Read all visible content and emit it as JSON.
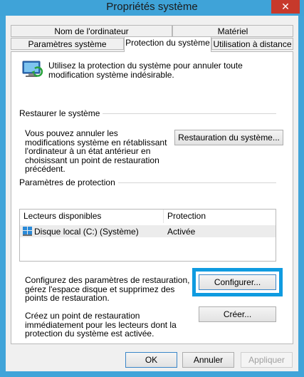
{
  "window": {
    "title": "Propriétés système",
    "close_glyph": "✕"
  },
  "tabs": {
    "row1": [
      "Nom de l'ordinateur",
      "Matériel"
    ],
    "row2": [
      "Paramètres système avancés",
      "Protection du système",
      "Utilisation à distance"
    ]
  },
  "intro": {
    "text": "Utilisez la protection du système pour annuler toute modification système indésirable."
  },
  "restore": {
    "group_label": "Restaurer le système",
    "description": "Vous pouvez annuler les modifications système en rétablissant l'ordinateur à un état antérieur en choisissant un point de restauration précédent.",
    "button_label": "Restauration du système..."
  },
  "protection": {
    "group_label": "Paramètres de protection",
    "columns": [
      "Lecteurs disponibles",
      "Protection"
    ],
    "drives": [
      {
        "name": "Disque local (C:) (Système)",
        "status": "Activée"
      }
    ],
    "configure_text": "Configurez des paramètres de restauration, gérez l'espace disque et supprimez des points de restauration.",
    "configure_label": "Configurer...",
    "create_text": "Créez un point de restauration immédiatement pour les lecteurs dont la protection du système est activée.",
    "create_label": "Créer..."
  },
  "footer": {
    "ok": "OK",
    "cancel": "Annuler",
    "apply": "Appliquer"
  },
  "colors": {
    "accent": "#0f9be0",
    "titlebar": "#3fa3d8",
    "close": "#c7392b"
  }
}
